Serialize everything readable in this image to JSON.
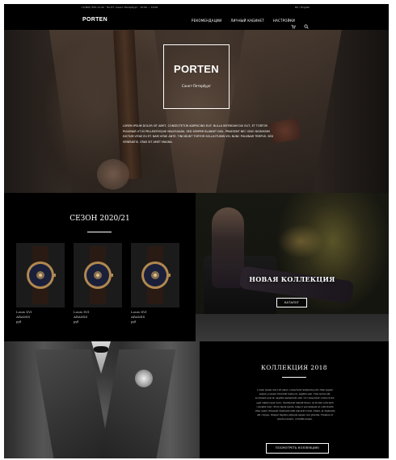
{
  "topbar": {
    "contact": "+7(800) 555-11-22 · Пн-Пт, Санкт-Петербург · 10:00 — 19:00",
    "lang": "RU / English"
  },
  "nav": {
    "logo": "PORTEN",
    "links": [
      "Рекомендации",
      "Личный кабинет",
      "Настройки"
    ],
    "icons": [
      "cart-icon",
      "search-icon"
    ]
  },
  "hero": {
    "logo_title": "PORTEN",
    "logo_subtitle": "Санкт-Петербург",
    "text": "Lorem ipsum dolor sit amet, consectetur adipiscing elit. Nulla interdum dui elit, et tortor pulvinar ut in pellentesque malesuada. Sed semper blandit nisl. Praesent nec odio dignissim dictum vitae eu et. Nam vitae ante. Tincidunt tortor sollicitudin vel nunc pulvinar tempus. Sed venenatis. Cras sit amet magna."
  },
  "season": {
    "title": "СЕЗОН 2020/21",
    "products": [
      {
        "name": "Louis XVI",
        "model": "ARAMIS",
        "price": "руб"
      },
      {
        "name": "Louis XVI",
        "model": "ARAMIS",
        "price": "руб"
      },
      {
        "name": "Louis XVI",
        "model": "ARAMIS",
        "price": "руб"
      }
    ]
  },
  "new_collection": {
    "title": "НОВАЯ КОЛЛЕКЦИЯ",
    "button": "Каталог"
  },
  "collection_2018": {
    "title": "КОЛЛЕКЦИЯ 2018",
    "body": "Lorem ipsum dolor sit amet, consectetur adipiscing elit. Nam sapien sapien, posuere tincidunt metus in, sagittis sem. Cras lectus elit, accumsan quis at, sagittis elementum erat. Ut consectetur cursus dolor, eget ullamcorper nunc. Vestibulum blandit libero, at dictum velit nibh convallis nunc. Proin ligula ipsum, tempor sed aliquam at, sollicitudin vitae quam. Praesent dignissim nibh placerat lorem ornare, at dignissim elit congue. Integer dapibus aliquam sapien non gravida. Vivamus ut ipsum posuere, convallis augue.",
    "button": "Посмотреть коллекцию"
  },
  "colors": {
    "background": "#000000",
    "text": "#ffffff"
  }
}
